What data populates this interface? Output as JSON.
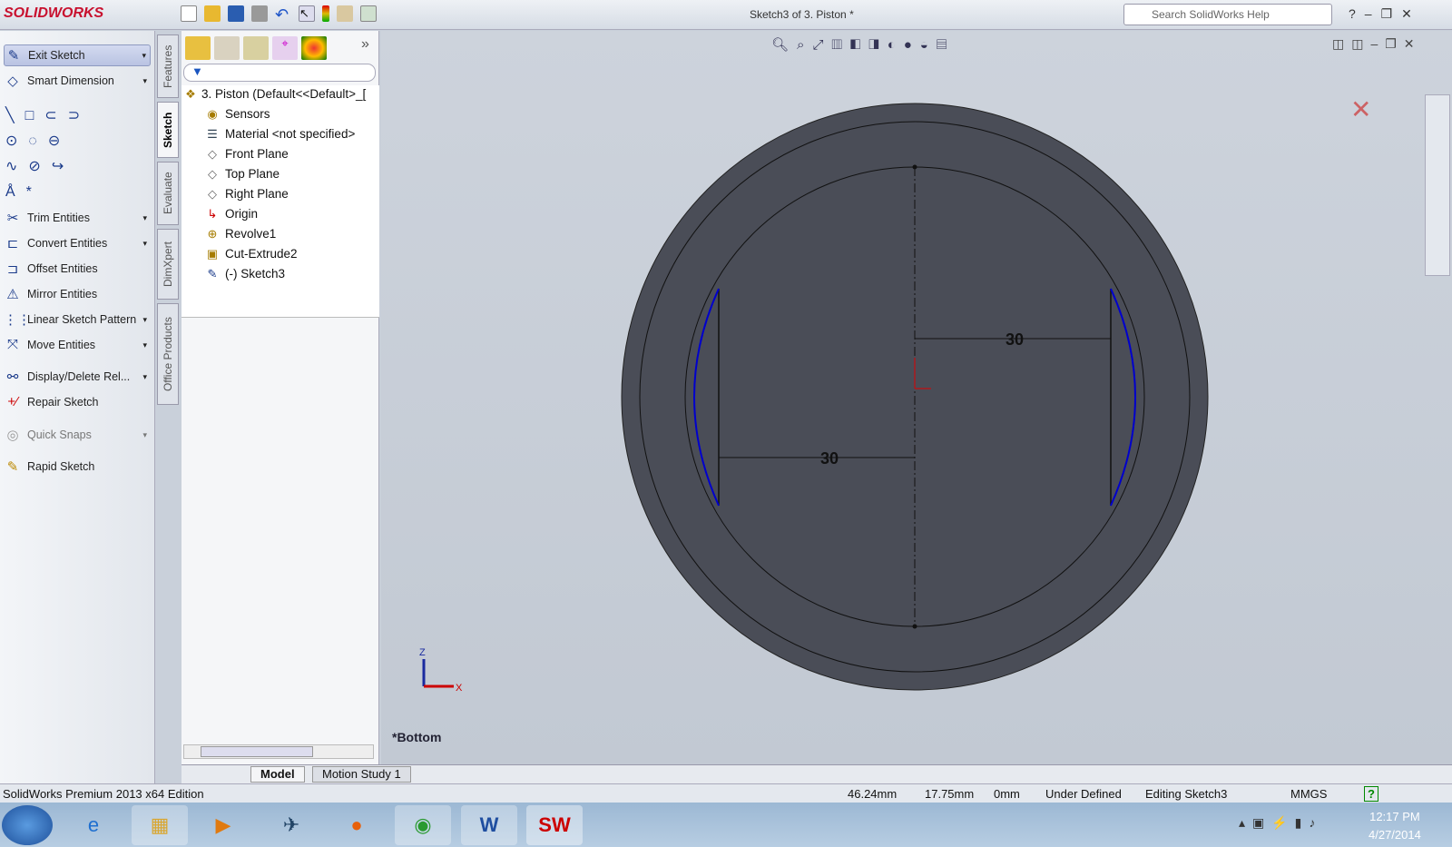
{
  "app": {
    "logo": "SOLIDWORKS",
    "title": "Sketch3 of 3. Piston *",
    "search_placeholder": "Search SolidWorks Help"
  },
  "command_manager": {
    "items": [
      {
        "label": "Exit Sketch",
        "icon": "exit-sketch-icon"
      },
      {
        "label": "Smart Dimension",
        "icon": "smart-dimension-icon"
      },
      {
        "label": "Trim Entities",
        "icon": "trim-icon"
      },
      {
        "label": "Convert Entities",
        "icon": "convert-icon"
      },
      {
        "label": "Offset Entities",
        "icon": "offset-icon"
      },
      {
        "label": "Mirror Entities",
        "icon": "mirror-icon"
      },
      {
        "label": "Linear Sketch Pattern",
        "icon": "pattern-icon"
      },
      {
        "label": "Move Entities",
        "icon": "move-icon"
      },
      {
        "label": "Display/Delete Rel...",
        "icon": "relations-icon"
      },
      {
        "label": "Repair Sketch",
        "icon": "repair-icon"
      },
      {
        "label": "Quick Snaps",
        "icon": "snaps-icon"
      },
      {
        "label": "Rapid Sketch",
        "icon": "rapid-sketch-icon"
      }
    ]
  },
  "vertical_tabs": [
    "Features",
    "Sketch",
    "Evaluate",
    "DimXpert",
    "Office Products"
  ],
  "feature_tree": {
    "root": "3. Piston  (Default<<Default>_[",
    "nodes": [
      "Sensors",
      "Material <not specified>",
      "Front Plane",
      "Top Plane",
      "Right Plane",
      "Origin",
      "Revolve1",
      "Cut-Extrude2",
      "(-) Sketch3"
    ]
  },
  "viewport": {
    "view_name": "*Bottom",
    "dimensions": [
      "30",
      "30"
    ],
    "triad": {
      "z": "Z",
      "x": "X"
    },
    "colors": {
      "sketch": "#0000cc",
      "body": "#4a4d57",
      "origin": "#dd0000"
    }
  },
  "bottom_tabs": [
    "Model",
    "Motion Study 1"
  ],
  "status": {
    "edition": "SolidWorks Premium 2013 x64 Edition",
    "x": "46.24mm",
    "y": "17.75mm",
    "z": "0mm",
    "state": "Under Defined",
    "mode": "Editing Sketch3",
    "units": "MMGS"
  },
  "taskbar": {
    "time": "12:17 PM",
    "date": "4/27/2014"
  }
}
